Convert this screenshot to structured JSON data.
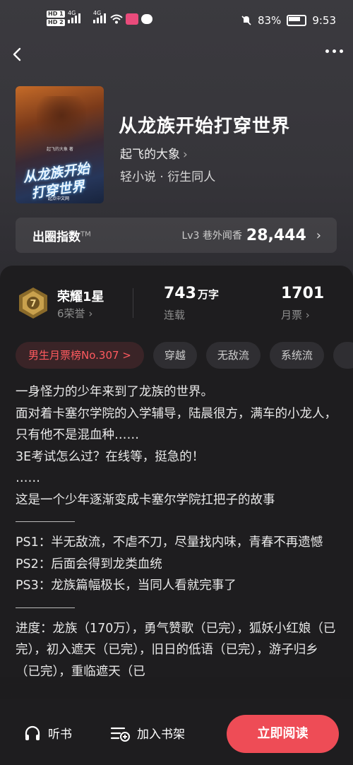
{
  "status_bar": {
    "battery": "83%",
    "time": "9:53",
    "hd1": "HD 1",
    "hd2": "HD 2",
    "net1": "4G",
    "net2": "4G"
  },
  "book": {
    "title": "从龙族开始打穿世界",
    "author": "起飞的大象",
    "genre": "轻小说 · 衍生同人",
    "cover_title_line1": "从龙族开始",
    "cover_title_line2": "打穿世界",
    "cover_author": "起飞的大象 著",
    "cover_publisher": "起点中文网"
  },
  "circle_index": {
    "label": "出圈指数",
    "tm": "TM",
    "level": "Lv3 巷外闻香",
    "value": "28,444"
  },
  "honor": {
    "title": "荣耀1星",
    "sub": "6荣誉",
    "medal_number": "7"
  },
  "stats": {
    "words_num": "743",
    "words_unit": "万字",
    "words_label": "连载",
    "tickets_num": "1701",
    "tickets_label": "月票"
  },
  "tags": [
    "男生月票榜No.307 >",
    "穿越",
    "无敌流",
    "系统流"
  ],
  "description": {
    "intro": [
      "一身怪力的少年来到了龙族的世界。",
      "面对着卡塞尔学院的入学辅导，陆晨很方，满车的小龙人，只有他不是混血种……",
      "3E考试怎么过？在线等，挺急的！",
      "……",
      "这是一个少年逐渐变成卡塞尔学院扛把子的故事"
    ],
    "ps": [
      "PS1：半无敌流，不虐不刀，尽量找内味，青春不再遗憾",
      "PS2：后面会得到龙类血统",
      "PS3：龙族篇幅极长，当同人看就完事了"
    ],
    "progress": "进度：龙族（170万），勇气赞歌（已完），狐妖小红娘（已完），初入遮天（已完），旧日的低语（已完），游子归乡（已完），重临遮天（已"
  },
  "bottom": {
    "listen": "听书",
    "shelf": "加入书架",
    "read": "立即阅读"
  },
  "colors": {
    "accent": "#ee4c56",
    "rank_tag": "#ff5a5f",
    "panel": "#1e1d1f",
    "hero": "#3b3a3f"
  }
}
